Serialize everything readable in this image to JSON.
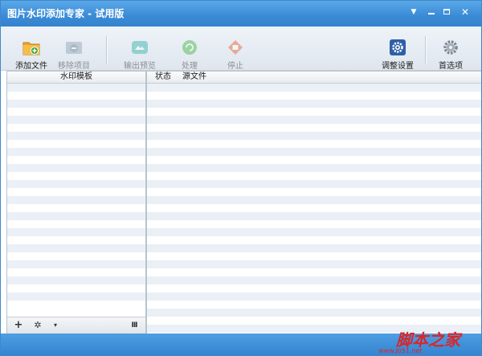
{
  "window": {
    "title": "图片水印添加专家 - 试用版",
    "controls": [
      "pin-icon",
      "minimize-icon",
      "maximize-icon",
      "close-icon"
    ]
  },
  "toolbar": {
    "add_file": {
      "label": "添加文件",
      "icon": "folder-add-icon",
      "enabled": true
    },
    "remove_item": {
      "label": "移除项目",
      "icon": "remove-icon",
      "enabled": false
    },
    "output_preview": {
      "label": "输出预览",
      "icon": "preview-icon",
      "enabled": false
    },
    "process": {
      "label": "处理",
      "icon": "process-icon",
      "enabled": false
    },
    "stop": {
      "label": "停止",
      "icon": "stop-icon",
      "enabled": false
    },
    "adjust_settings": {
      "label": "调整设置",
      "icon": "settings-gear-icon",
      "enabled": true
    },
    "preferences": {
      "label": "首选项",
      "icon": "preferences-gear-icon",
      "enabled": true
    }
  },
  "left_panel": {
    "header": "水印模板",
    "tools": {
      "add": "+",
      "settings": "✲",
      "dropdown": "▾",
      "columns": "III"
    }
  },
  "right_panel": {
    "columns": [
      "状态",
      "源文件"
    ]
  },
  "watermark": {
    "main": "脚本之家",
    "sub": "www.jb51.net"
  },
  "colors": {
    "title_bar": "#3a8ad6",
    "status_bar": "#3584d0",
    "stripe": "#eaf0f6",
    "watermark": "#d9262a"
  }
}
